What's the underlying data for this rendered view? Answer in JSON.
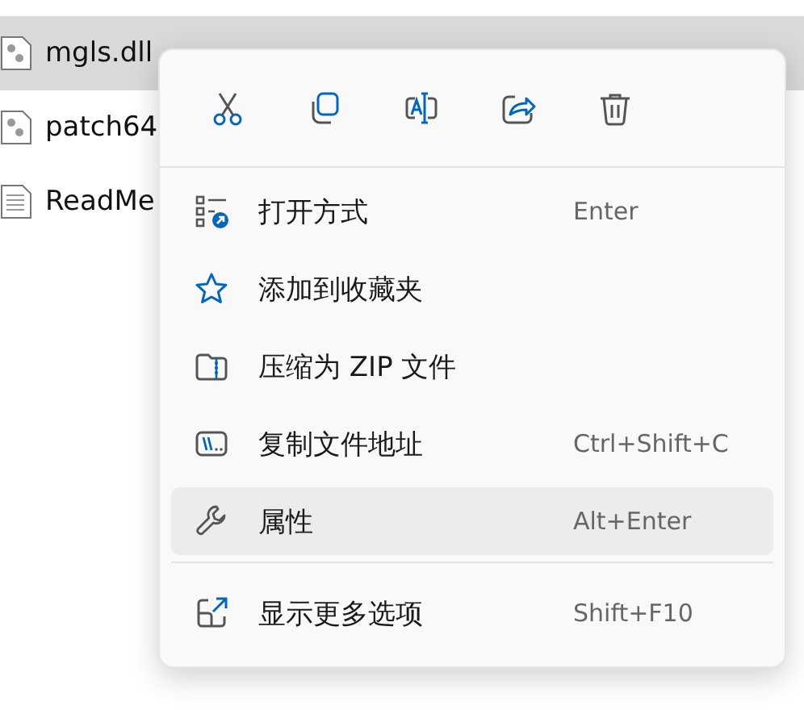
{
  "files": [
    {
      "name": "mgls.dll",
      "kind": "dll",
      "selected": true
    },
    {
      "name": "patch64",
      "kind": "dll",
      "selected": false
    },
    {
      "name": "ReadMe",
      "kind": "text",
      "selected": false
    }
  ],
  "context_menu": {
    "items": [
      {
        "label": "打开方式",
        "shortcut": "Enter",
        "selected": false
      },
      {
        "label": "添加到收藏夹",
        "selected": false
      },
      {
        "label": "压缩为 ZIP 文件",
        "selected": false
      },
      {
        "label": "复制文件地址",
        "shortcut": "Ctrl+Shift+C",
        "selected": false
      },
      {
        "label": "属性",
        "shortcut": "Alt+Enter",
        "selected": true
      }
    ],
    "footer_items": [
      {
        "label": "显示更多选项",
        "shortcut": "Shift+F10",
        "selected": false
      }
    ]
  }
}
